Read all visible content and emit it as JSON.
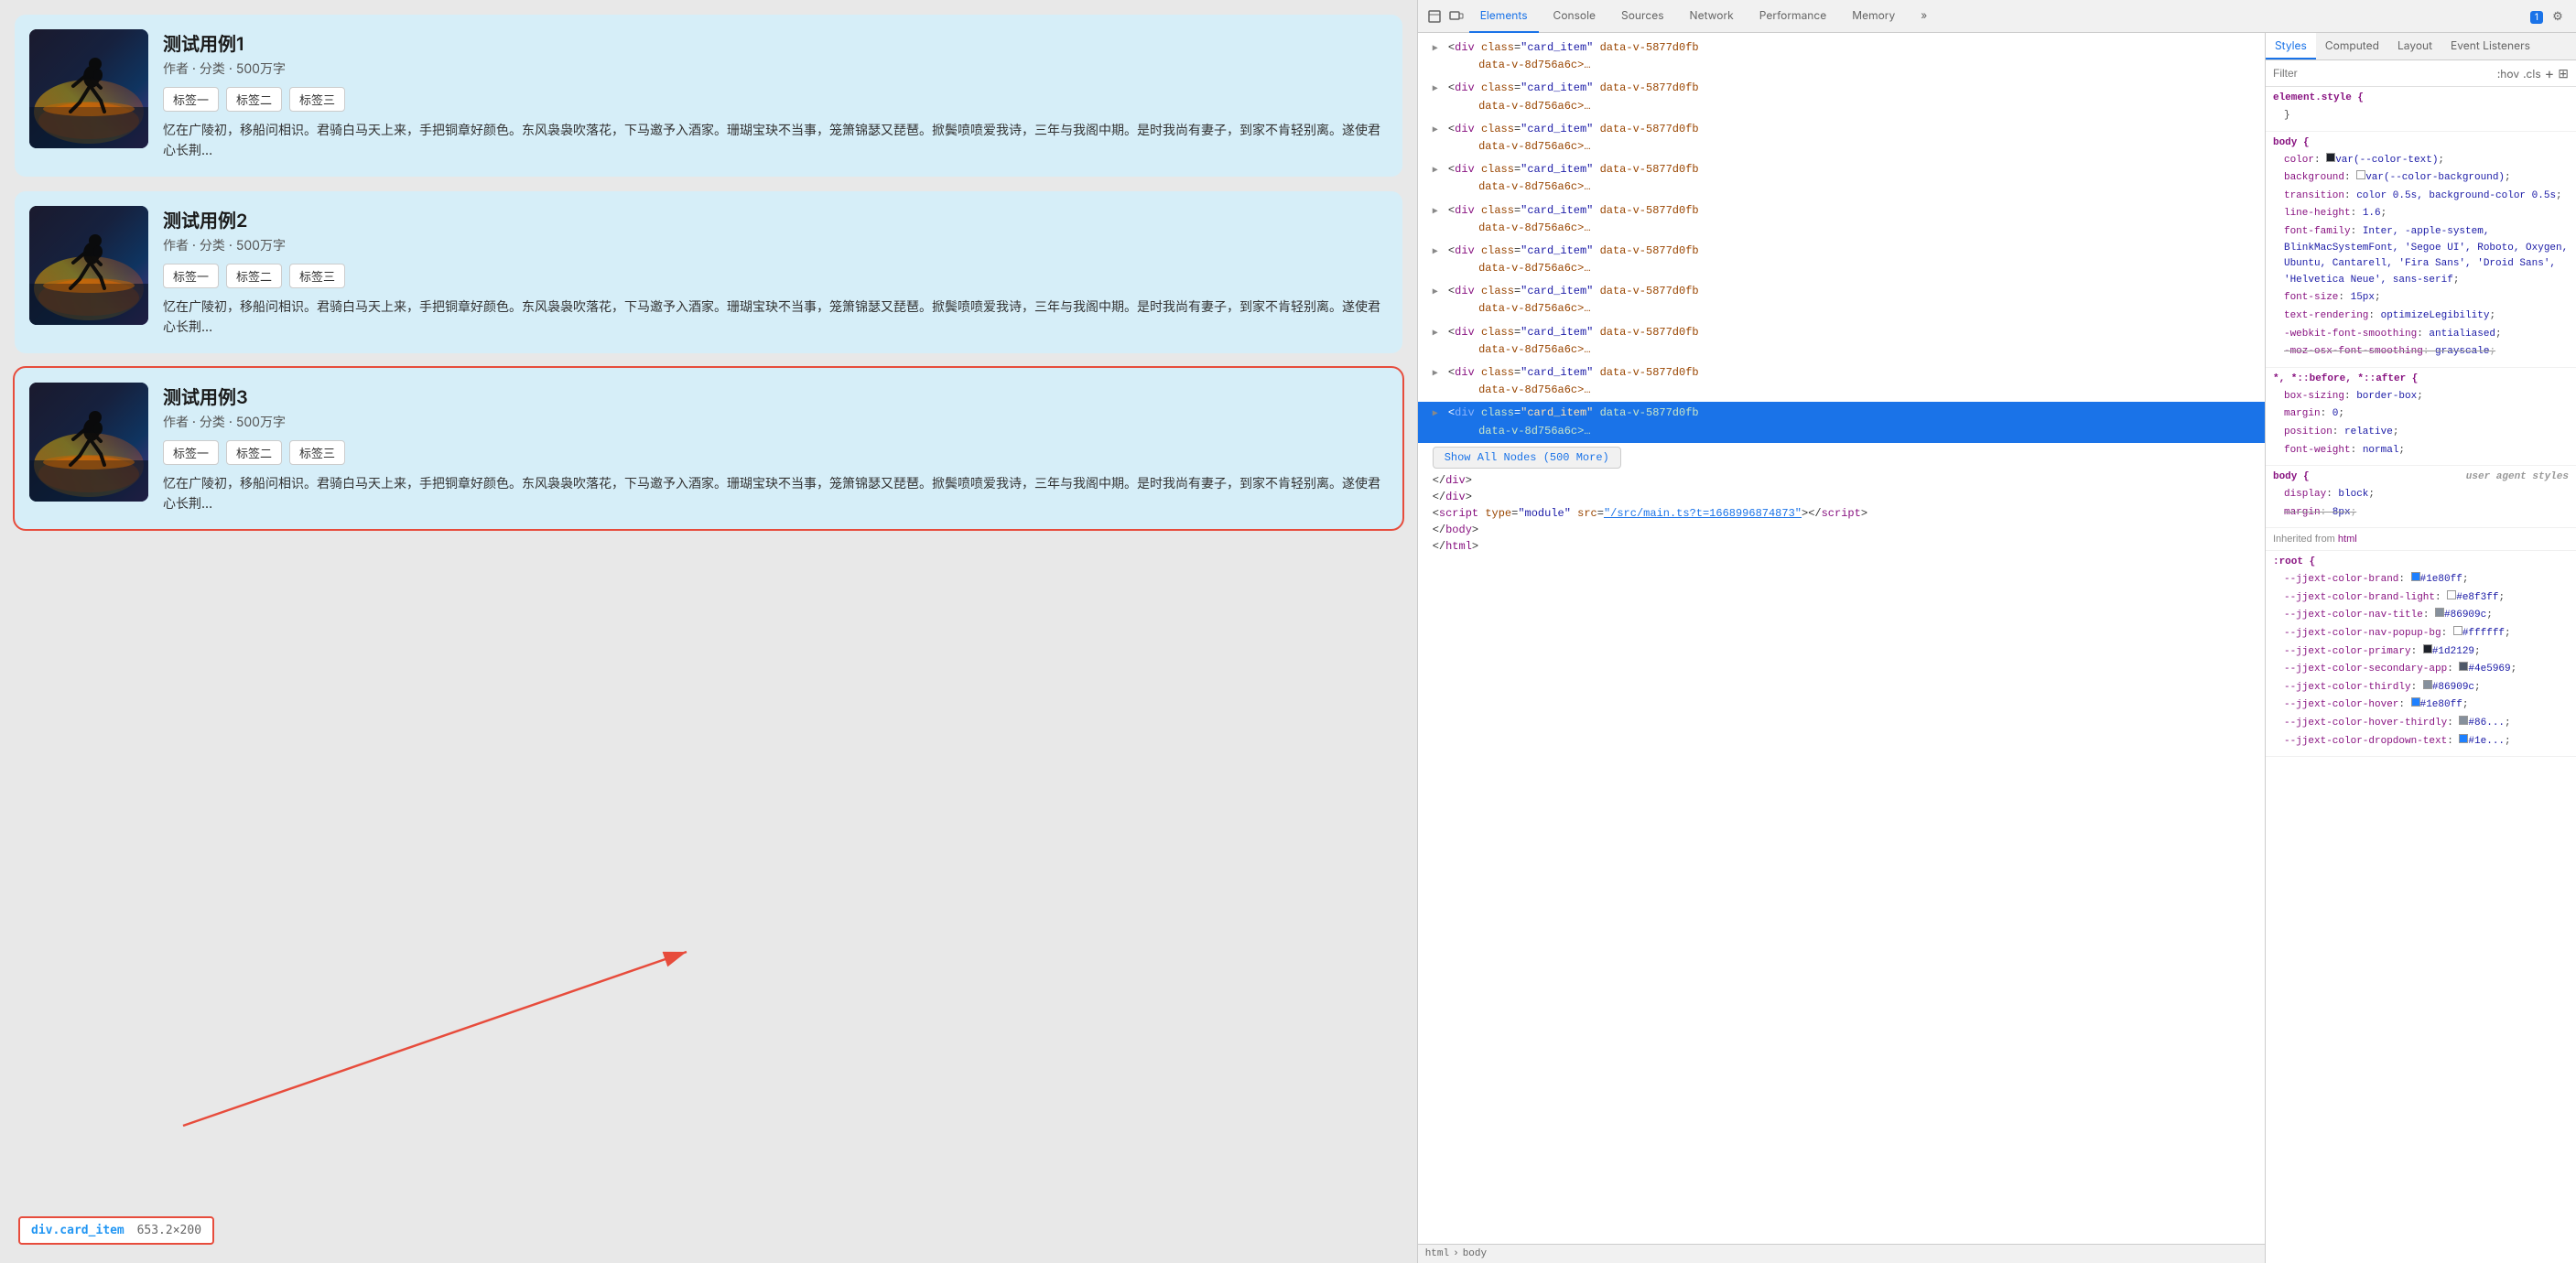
{
  "leftPanel": {
    "cards": [
      {
        "id": 1,
        "title": "测试用例1",
        "meta": "作者 · 分类 · 500万字",
        "tags": [
          "标签一",
          "标签二",
          "标签三"
        ],
        "desc": "忆在广陵初，移船问相识。君骑白马天上来，手把铜章好颜色。东风袅袅吹落花，下马邀予入酒家。珊瑚宝玦不当事，笼箫锦瑟又琵琶。掀鬓喷喷爱我诗，三年与我阁中期。是时我尚有妻子，到家不肯轻别离。遂使君心长荆...",
        "selected": false
      },
      {
        "id": 2,
        "title": "测试用例2",
        "meta": "作者 · 分类 · 500万字",
        "tags": [
          "标签一",
          "标签二",
          "标签三"
        ],
        "desc": "忆在广陵初，移船问相识。君骑白马天上来，手把铜章好颜色。东风袅袅吹落花，下马邀予入酒家。珊瑚宝玦不当事，笼箫锦瑟又琵琶。掀鬓喷喷爱我诗，三年与我阁中期。是时我尚有妻子，到家不肯轻别离。遂使君心长荆...",
        "selected": false
      },
      {
        "id": 3,
        "title": "测试用例3",
        "meta": "作者 · 分类 · 500万字",
        "tags": [
          "标签一",
          "标签二",
          "标签三"
        ],
        "desc": "忆在广陵初，移船问相识。君骑白马天上来，手把铜章好颜色。东风袅袅吹落花，下马邀予入酒家。珊瑚宝玦不当事，笼箫锦瑟又琵琶。掀鬓喷喷爱我诗，三年与我阁中期。是时我尚有妻子，到家不肯轻别离。遂使君心长荆...",
        "selected": true
      }
    ]
  },
  "elementBadge": {
    "name": "div.card_item",
    "size": "653.2×200"
  },
  "devtools": {
    "tabs": [
      "Elements",
      "Console",
      "Sources",
      "Network",
      "Performance",
      "Memory",
      "»"
    ],
    "activeTab": "Elements",
    "badgeCount": "1",
    "domNodes": [
      {
        "class": "card_item",
        "attr": "data-v-5877d0fb",
        "extra": "data-v-8d756a6c>…</div>"
      },
      {
        "class": "card_item",
        "attr": "data-v-5877d0fb",
        "extra": "data-v-8d756a6c>…</div>"
      },
      {
        "class": "card_item",
        "attr": "data-v-5877d0fb",
        "extra": "data-v-8d756a6c>…</div>"
      },
      {
        "class": "card_item",
        "attr": "data-v-5877d0fb",
        "extra": "data-v-8d756a6c>…</div>"
      },
      {
        "class": "card_item",
        "attr": "data-v-5877d0fb",
        "extra": "data-v-8d756a6c>…</div>"
      },
      {
        "class": "card_item",
        "attr": "data-v-5877d0fb",
        "extra": "data-v-8d756a6c>…</div>"
      },
      {
        "class": "card_item",
        "attr": "data-v-5877d0fb",
        "extra": "data-v-8d756a6c>…</div>"
      },
      {
        "class": "card_item",
        "attr": "data-v-5877d0fb",
        "extra": "data-v-8d756a6c>…</div>"
      },
      {
        "class": "card_item",
        "attr": "data-v-5877d0fb",
        "extra": "data-v-8d756a6c>…</div>"
      },
      {
        "class": "card_item",
        "attr": "data-v-5877d0fb",
        "extra": "data-v-8d756a6c>…</div>",
        "highlighted": true
      }
    ],
    "showAllNodes": "Show All Nodes (500 More)",
    "closingTags": [
      "</div>",
      "</div>"
    ],
    "scriptSrc": "/src/main.ts?t=1668996874873",
    "bottomTags": [
      "</body>",
      "</html>"
    ],
    "breadcrumb": [
      "html",
      "body"
    ],
    "stylesPanelTabs": [
      "Styles",
      "Computed",
      "Layout",
      "Event Listeners"
    ],
    "activeStylesTab": "Styles",
    "filterPlaceholder": "Filter",
    "filterHov": ":hov",
    "filterCls": ".cls",
    "styleRules": [
      {
        "selector": "element.style {",
        "source": "",
        "props": [
          {
            "name": "",
            "value": "}"
          }
        ]
      },
      {
        "selector": "body {",
        "source": "<st",
        "props": [
          {
            "name": "color",
            "value": "var(--color-text)",
            "colorBox": "#1d2129"
          },
          {
            "name": "background",
            "value": "var(--color-background)",
            "checkBox": true
          },
          {
            "name": "transition",
            "value": "color 0.5s, background-color 0.5s"
          },
          {
            "name": "line-height",
            "value": "1.6"
          },
          {
            "name": "font-family",
            "value": "Inter, -apple-system, BlinkMacSystemFont, 'Segoe UI', Roboto, Oxygen, Ubuntu, Cantarell, 'Fira Sans', 'Droid Sans', 'Helvetica Neue', sans-serif"
          },
          {
            "name": "font-size",
            "value": "15px"
          },
          {
            "name": "text-rendering",
            "value": "optimizeLegibility"
          },
          {
            "name": "-webkit-font-smoothing",
            "value": "antialiased"
          },
          {
            "name": "-moz-osx-font-smoothing",
            "value": "grayscale",
            "strikethrough": true
          }
        ]
      },
      {
        "selector": "*, *::before, *::after {",
        "source": "<st",
        "props": [
          {
            "name": "box-sizing",
            "value": "border-box"
          },
          {
            "name": "margin",
            "value": "0"
          },
          {
            "name": "position",
            "value": "relative"
          },
          {
            "name": "font-weight",
            "value": "normal"
          }
        ]
      },
      {
        "selector": "body {",
        "source": "user agent styles",
        "props": [
          {
            "name": "display",
            "value": "block"
          },
          {
            "name": "margin",
            "value": "8px",
            "strikethrough": true
          }
        ]
      },
      {
        "selector": "Inherited from html",
        "isInherited": true,
        "props": []
      },
      {
        "selector": ":root {",
        "source": "<st",
        "props": [
          {
            "name": "--jjext-color-brand",
            "value": "#1e80ff",
            "colorBox": "#1e80ff"
          },
          {
            "name": "--jjext-color-brand-light",
            "value": "#e8f3ff",
            "checkBox": true
          },
          {
            "name": "--jjext-color-nav-title",
            "value": "#86909c",
            "colorBox": "#86909c"
          },
          {
            "name": "--jjext-color-nav-popup-bg",
            "value": "#ffffff",
            "checkBox": true
          },
          {
            "name": "--jjext-color-primary",
            "value": "#1d2129",
            "colorBox": "#1d2129"
          },
          {
            "name": "--jjext-color-secondary-app",
            "value": "#4e5969",
            "colorBox": "#4e5969"
          },
          {
            "name": "--jjext-color-thirdly",
            "value": "#86909c",
            "colorBox": "#86909c"
          },
          {
            "name": "--jjext-color-hover",
            "value": "#1e80ff",
            "colorBox": "#1e80ff"
          },
          {
            "name": "--jjext-color-hover-thirdly",
            "value": "#86...",
            "colorBox": "#86909c"
          },
          {
            "name": "--jjext-color-dropdown-text",
            "value": "#1e...",
            "colorBox": "#1e80ff"
          }
        ]
      }
    ]
  }
}
